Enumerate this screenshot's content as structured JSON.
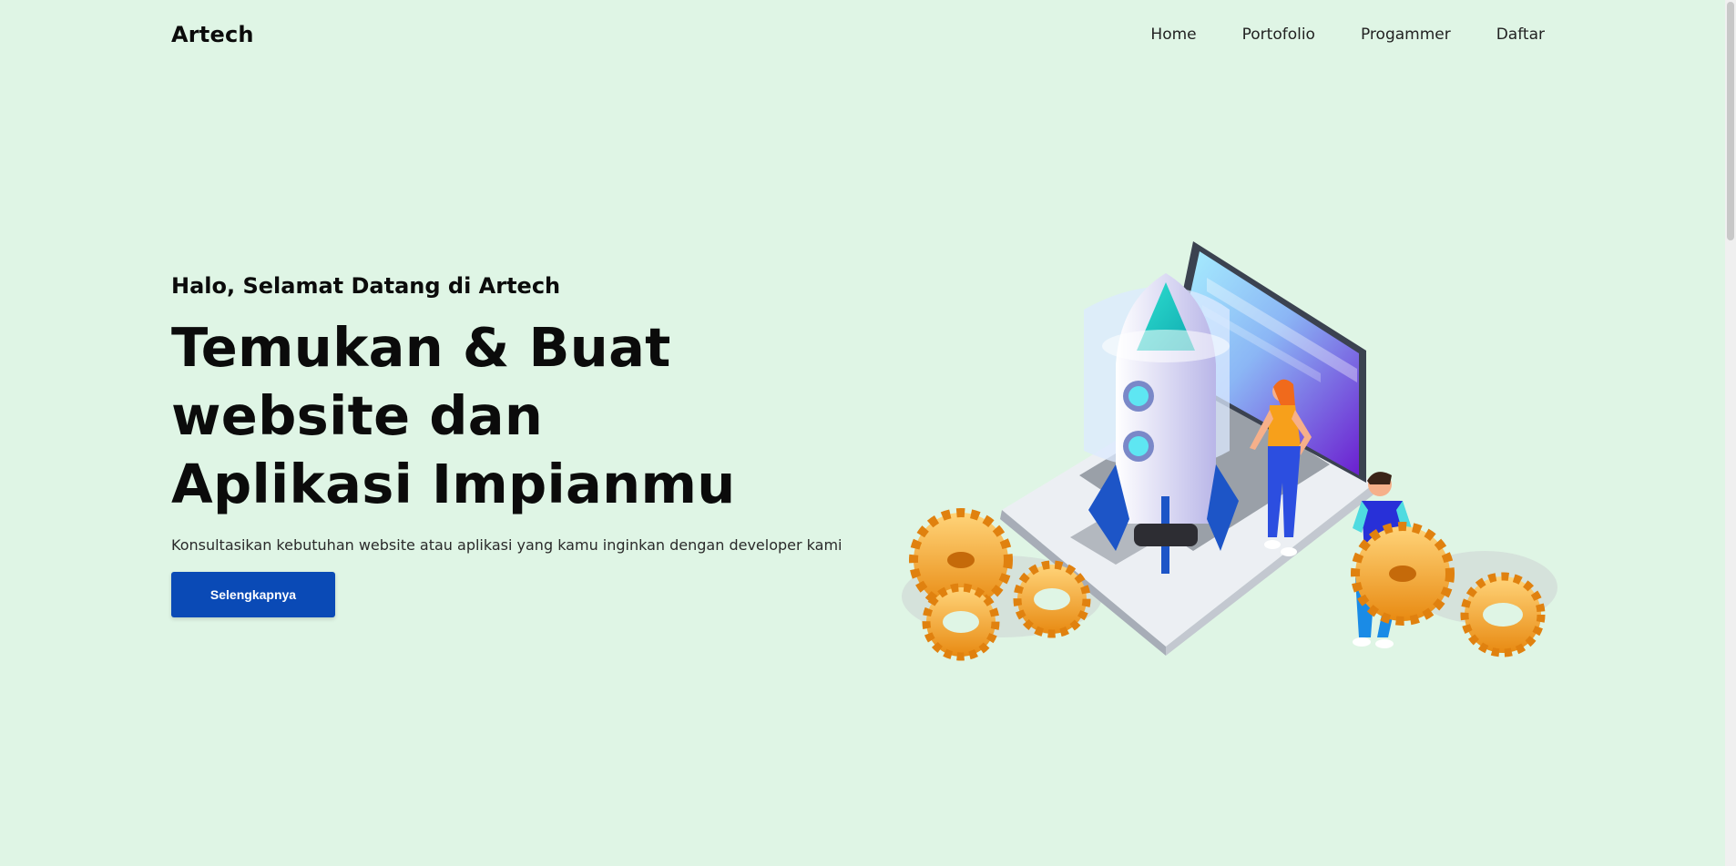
{
  "navbar": {
    "brand": "Artech",
    "links": [
      "Home",
      "Portofolio",
      "Progammer",
      "Daftar"
    ]
  },
  "hero": {
    "greeting": "Halo, Selamat Datang di Artech",
    "title_lines": [
      "Temukan & Buat",
      "website dan",
      "Aplikasi Impianmu"
    ],
    "description": "Konsultasikan kebutuhan website atau aplikasi yang kamu inginkan dengan developer kami",
    "cta_label": "Selengkapnya"
  },
  "illustration": {
    "icon": "rocket-laptop-illustration",
    "elements": [
      "laptop",
      "rocket",
      "woman",
      "man",
      "gears"
    ]
  },
  "colors": {
    "background": "#dff5e5",
    "accent": "#0a4ab6",
    "text": "#0b0b0b"
  }
}
